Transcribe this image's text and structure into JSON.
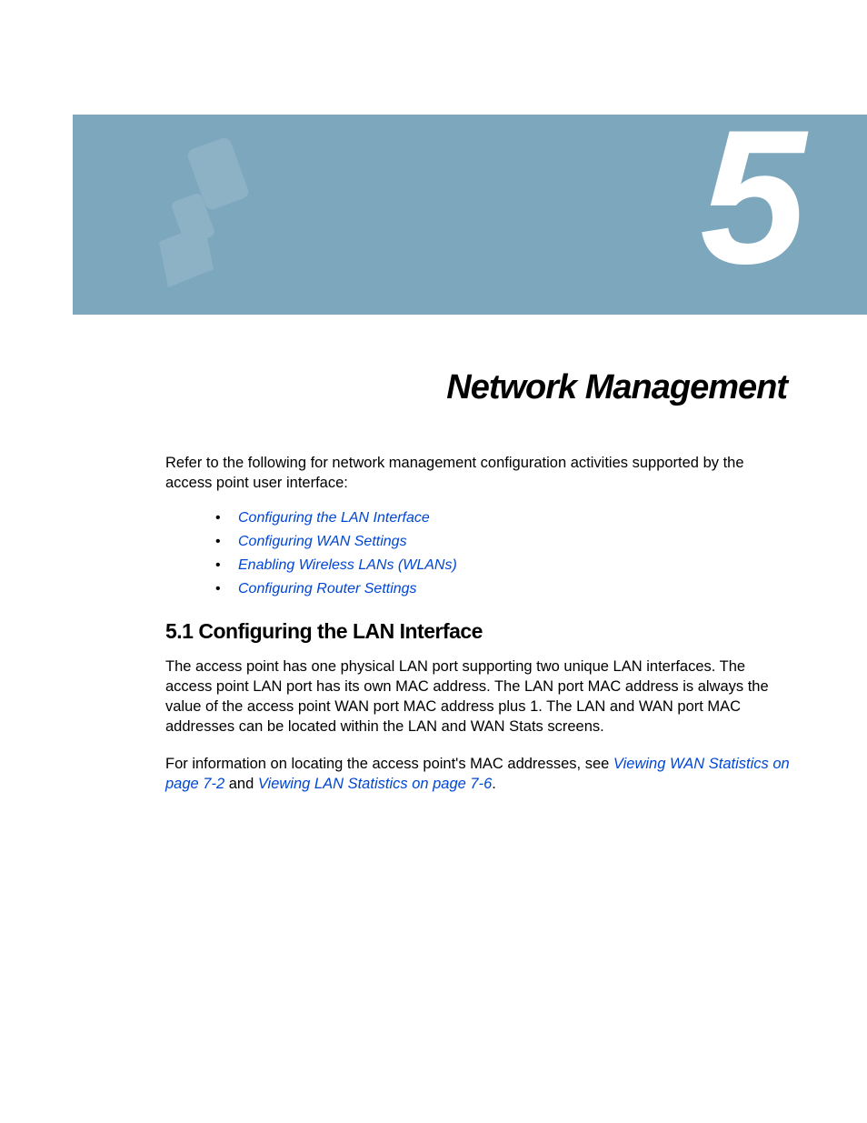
{
  "chapter": {
    "number": "5",
    "title": "Network Management"
  },
  "intro": "Refer to the following for network management configuration activities supported by the access point user interface:",
  "bullets": [
    "Configuring the LAN Interface",
    "Configuring WAN Settings",
    "Enabling Wireless LANs (WLANs)",
    "Configuring Router Settings"
  ],
  "section": {
    "heading": "5.1  Configuring the LAN Interface",
    "para1": "The access point has one physical LAN port supporting two unique LAN interfaces. The access point LAN port has its own MAC address. The LAN port MAC address is always the value of the access point WAN port MAC address plus 1. The LAN and WAN port MAC addresses can be located within the LAN and WAN Stats screens.",
    "para2_prefix": "For information on locating the access point's MAC addresses, see ",
    "para2_link1": "Viewing WAN Statistics on page 7-2",
    "para2_mid": " and ",
    "para2_link2": "Viewing LAN Statistics on page 7-6",
    "para2_suffix": "."
  }
}
